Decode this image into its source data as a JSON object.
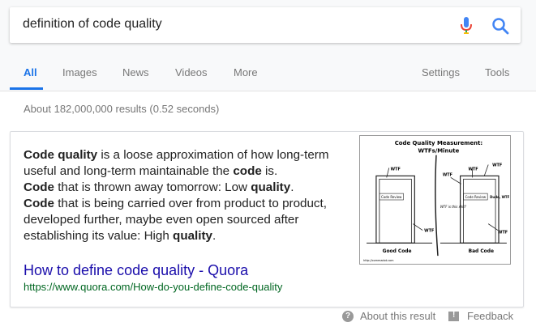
{
  "search": {
    "query": "definition of code quality"
  },
  "tabs": [
    {
      "label": "All",
      "active": true
    },
    {
      "label": "Images"
    },
    {
      "label": "News"
    },
    {
      "label": "Videos"
    },
    {
      "label": "More"
    },
    {
      "label": "Settings"
    },
    {
      "label": "Tools"
    }
  ],
  "results_count": "About 182,000,000 results (0.52 seconds)",
  "snippet": {
    "s1_b": "Code quality",
    "s1": " is a loose approximation of how long-term useful and long-term maintainable the ",
    "s1_b2": "code",
    "s1_end": " is.",
    "s2_b": "Code",
    "s2": " that is thrown away tomorrow: Low ",
    "s2_b2": "quality",
    "s2_end": ".",
    "s3_b": "Code",
    "s3": " that is being carried over from product to product, developed further, maybe even open sourced after establishing its value: High ",
    "s3_b2": "quality",
    "s3_end": "."
  },
  "result": {
    "title": "How to define code quality - Quora",
    "url": "https://www.quora.com/How-do-you-define-code-quality"
  },
  "thumbnail": {
    "title_line1": "Code Quality Measurement:",
    "title_line2": "WTFs/Minute",
    "left_caption": "Good Code",
    "right_caption": "Bad Code",
    "door_label": "Code Review",
    "wtf": "WTF",
    "wtf_question": "WTF is this shit?",
    "dude": "Dude, WTF",
    "credit": "http://commadot.com"
  },
  "footer": {
    "about": "About this result",
    "feedback": "Feedback"
  },
  "colors": {
    "link": "#1a0dab",
    "url": "#006621",
    "accent": "#1a73e8"
  }
}
